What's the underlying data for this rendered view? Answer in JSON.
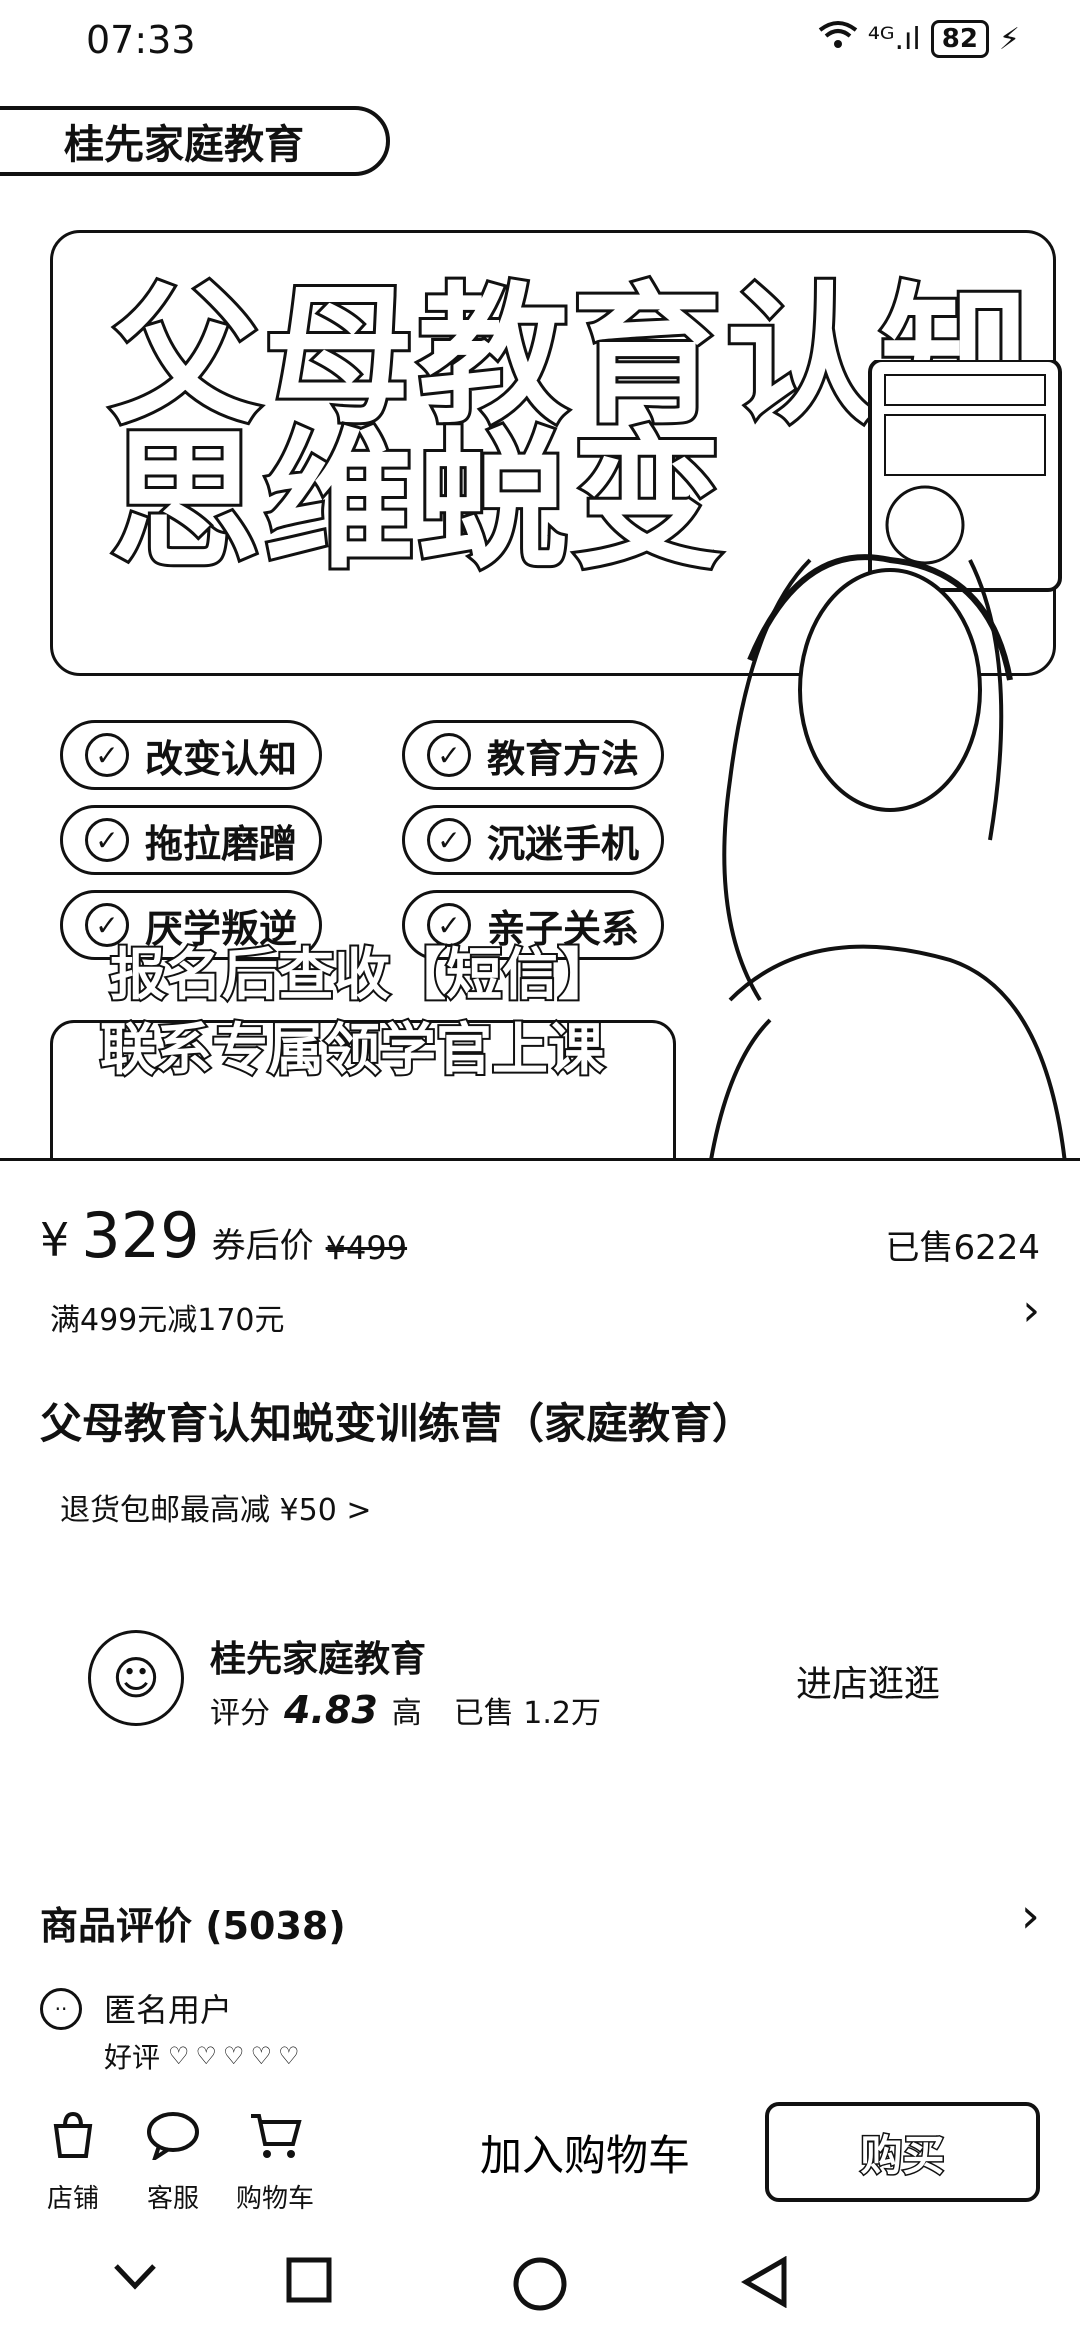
{
  "status_bar": {
    "time": "07:33",
    "signal": "⁴ᴳ.ıl",
    "battery": "82"
  },
  "hero": {
    "brand_pill": "桂先家庭教育",
    "title_line1": "父母教育认知",
    "title_line2": "思维蜕变",
    "tags": [
      "改变认知",
      "教育方法",
      "拖拉磨蹭",
      "沉迷手机",
      "厌学叛逆",
      "亲子关系"
    ],
    "cta_line1": "报名后查收【短信】",
    "cta_line2": "联系专属领学官上课"
  },
  "price": {
    "symbol": "¥",
    "value": "329",
    "after_coupon": "券后价",
    "original": "¥499",
    "sold": "已售6224",
    "discount": "满499元减170元"
  },
  "product": {
    "title": "父母教育认知蜕变训练营（家庭教育）",
    "return_policy": "退货包邮最高减 ¥50 >"
  },
  "store": {
    "name": "桂先家庭教育",
    "score_label": "评分",
    "score": "4.83",
    "score_level": "高",
    "sold": "已售 1.2万",
    "enter_label": "进店逛逛"
  },
  "reviews": {
    "title": "商品评价 (5038)",
    "user": "匿名用户",
    "rating_label": "好评",
    "stars": 5
  },
  "action_bar": {
    "store_label": "店铺",
    "service_label": "客服",
    "cart_label": "购物车",
    "add_to_cart": "加入购物车",
    "buy": "购买"
  },
  "icons": {
    "store": "bag-icon",
    "service": "chat-bubble-icon",
    "cart": "cart-icon",
    "nav_down": "chevron-down-icon",
    "nav_home": "square-icon",
    "nav_circle": "circle-icon",
    "nav_back": "triangle-back-icon"
  }
}
